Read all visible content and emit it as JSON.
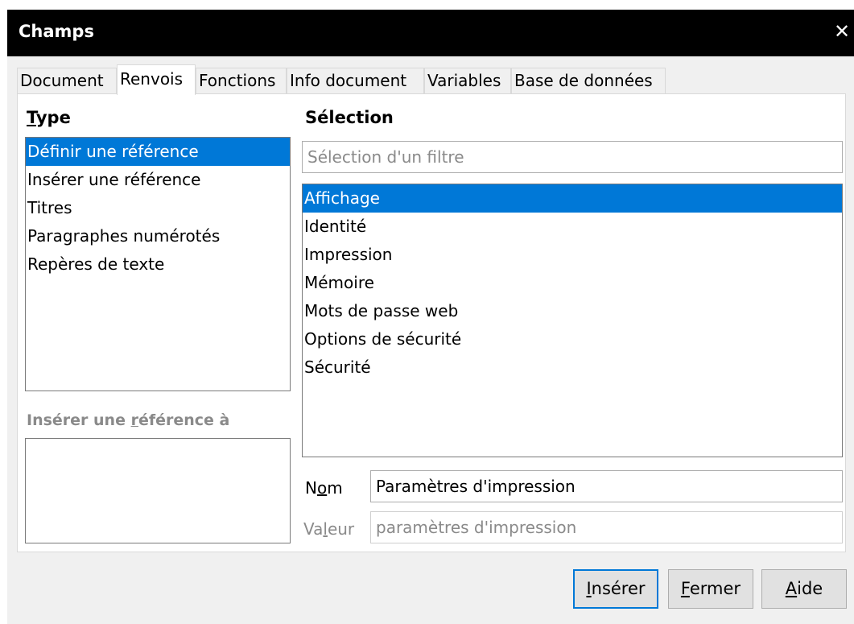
{
  "window": {
    "title": "Champs"
  },
  "tabs": [
    {
      "label": "Document"
    },
    {
      "label": "Renvois"
    },
    {
      "label": "Fonctions"
    },
    {
      "label": "Info document"
    },
    {
      "label": "Variables"
    },
    {
      "label": "Base de données"
    }
  ],
  "active_tab": "Renvois",
  "type_section": {
    "heading_first": "T",
    "heading_rest": "ype",
    "items": [
      {
        "label": "Définir une référence",
        "selected": true
      },
      {
        "label": "Insérer une référence"
      },
      {
        "label": "Titres"
      },
      {
        "label": "Paragraphes numérotés"
      },
      {
        "label": "Repères de texte"
      }
    ]
  },
  "insert_ref_section": {
    "heading_pre": "Insérer une ",
    "heading_key": "r",
    "heading_post": "éférence à"
  },
  "selection_section": {
    "heading": "Sélection",
    "filter_placeholder": "Sélection d'un filtre",
    "items": [
      {
        "label": "Affichage",
        "selected": true
      },
      {
        "label": "Identité"
      },
      {
        "label": "Impression"
      },
      {
        "label": "Mémoire"
      },
      {
        "label": "Mots de passe web"
      },
      {
        "label": "Options de sécurité"
      },
      {
        "label": "Sécurité"
      }
    ]
  },
  "fields": {
    "name_label_pre": "N",
    "name_label_key": "o",
    "name_label_post": "m",
    "name_value": "Paramètres d'impression",
    "value_label_pre": "Va",
    "value_label_key": "l",
    "value_label_post": "eur",
    "value_value": "paramètres d'impression"
  },
  "buttons": {
    "insert_key": "I",
    "insert_rest": "nsérer",
    "close_key": "F",
    "close_rest": "ermer",
    "help_key": "A",
    "help_rest": "ide"
  }
}
